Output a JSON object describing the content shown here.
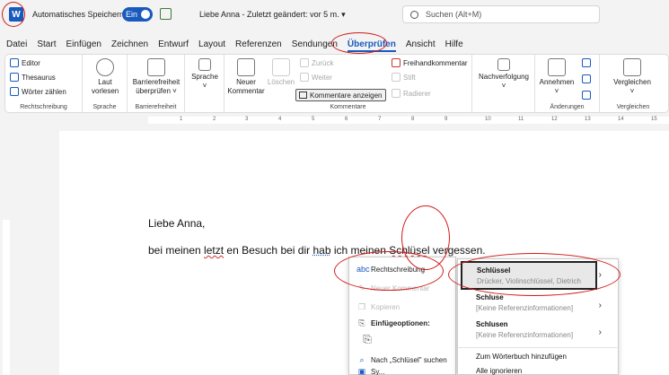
{
  "title_bar": {
    "autosave_label": "Automatisches Speichern",
    "autosave_state": "Ein",
    "doc_title": "Liebe Anna  -  Zuletzt geändert: vor 5 m.  ▾",
    "search_placeholder": "Suchen (Alt+M)",
    "accent_color": "#185abd"
  },
  "menu": {
    "items": [
      "Datei",
      "Start",
      "Einfügen",
      "Zeichnen",
      "Entwurf",
      "Layout",
      "Referenzen",
      "Sendungen",
      "Überprüfen",
      "Ansicht",
      "Hilfe"
    ],
    "active": "Überprüfen"
  },
  "ribbon": {
    "rechtschreibung": {
      "editor": "Editor",
      "thesaurus": "Thesaurus",
      "woerter": "Wörter zählen",
      "label": "Rechtschreibung"
    },
    "sprache1": {
      "laut": "Laut",
      "vorlesen": "vorlesen",
      "label": "Sprache"
    },
    "barriere": {
      "line1": "Barrierefreiheit",
      "line2": "überprüfen ˅",
      "label": "Barrierefreiheit"
    },
    "sprache2": {
      "btn": "Sprache",
      "caret": "˅"
    },
    "kommentare": {
      "neuer": "Neuer",
      "kommentar": "Kommentar",
      "loeschen": "Löschen",
      "zurueck": "Zurück",
      "weiter": "Weiter",
      "anzeigen": "Kommentare anzeigen",
      "freihand": "Freihandkommentar",
      "stift": "Stift",
      "radierer": "Radierer",
      "label": "Kommentare"
    },
    "nachverfolgung": {
      "btn": "Nachverfolgung",
      "caret": "˅"
    },
    "aenderungen": {
      "annehmen": "Annehmen",
      "caret": "˅",
      "label": "Änderungen"
    },
    "vergleichen": {
      "btn": "Vergleichen",
      "caret": "˅",
      "label": "Vergleichen"
    }
  },
  "ruler": [
    "1",
    "2",
    "3",
    "4",
    "5",
    "6",
    "7",
    "8",
    "9",
    "10",
    "11",
    "12",
    "13",
    "14",
    "15"
  ],
  "document": {
    "greeting": "Liebe Anna,",
    "line_pre": "bei meinen ",
    "line_err": "letzt",
    "line_mid": " en Besuch bei dir ",
    "line_hab": "hab",
    "line_post": " ich meinen ",
    "line_word": "Schlüsel",
    "line_end": " vergessen."
  },
  "context_menu": {
    "rechtschreibung": "Rechtschreibung",
    "hidden_item": "Neuer Kommentar",
    "kopieren": "Kopieren",
    "einfuege": "Einfügeoptionen:",
    "nach": "Nach „Schlüsel\" suchen",
    "last": "Sy..."
  },
  "submenu": {
    "suggestions": [
      {
        "word": "Schlüssel",
        "alt": "Drücker, Violinschlüssel, Dietrich"
      },
      {
        "word": "Schluse",
        "alt": "[Keine Referenzinformationen]"
      },
      {
        "word": "Schlusen",
        "alt": "[Keine Referenzinformationen]"
      }
    ],
    "add": "Zum Wörterbuch hinzufügen",
    "ignore": "Alle ignorieren"
  },
  "annotation_color": "#d21a1a"
}
